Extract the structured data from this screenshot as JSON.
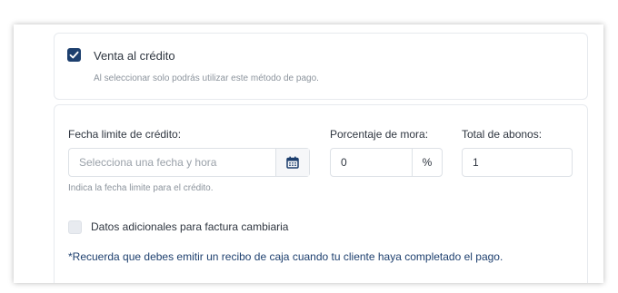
{
  "credit_sale": {
    "label": "Venta al crédito",
    "checked": true,
    "hint": "Al seleccionar solo podrás utilizar este método de pago."
  },
  "credit_form": {
    "date_label": "Fecha limite de crédito:",
    "date_placeholder": "Selecciona una fecha y hora",
    "date_icon": "calendar-icon",
    "date_hint": "Indica la fecha limite para el crédito.",
    "late_fee_label": "Porcentaje de mora:",
    "late_fee_value": "0",
    "late_fee_unit": "%",
    "installments_label": "Total de abonos:",
    "installments_value": "1",
    "extra_data_label": "Datos adicionales para factura cambiaria",
    "extra_data_checked": false,
    "reminder": "*Recuerda que debes emitir un recibo de caja cuando tu cliente haya completado el pago."
  },
  "colors": {
    "accent": "#1d3f6e",
    "border": "#dde1e6"
  }
}
